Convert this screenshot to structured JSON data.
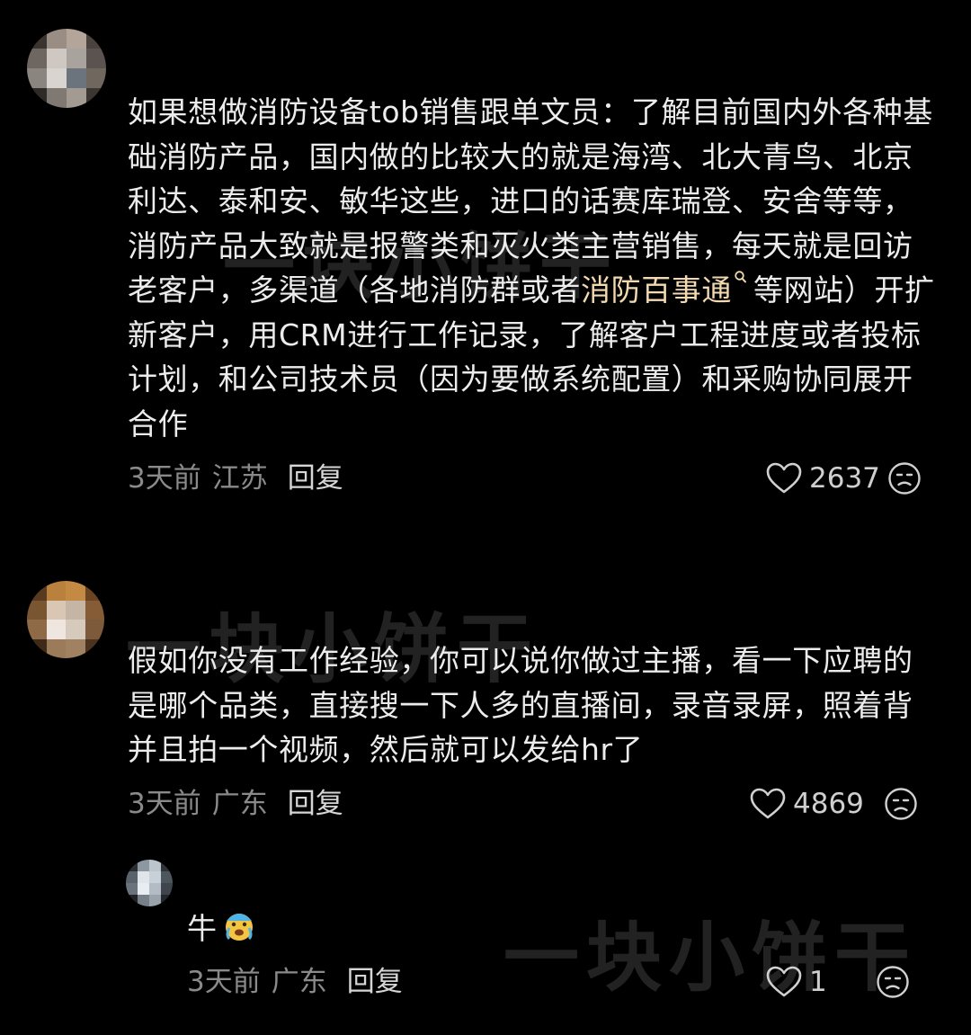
{
  "watermark": "一块小饼干",
  "comments": [
    {
      "text_before_link": "如果想做消防设备tob销售跟单文员：了解目前国内外各种基础消防产品，国内做的比较大的就是海湾、北大青鸟、北京利达、泰和安、敏华这些，进口的话赛库瑞登、安舍等等，消防产品大致就是报警类和灭火类主营销售，每天就是回访老客户，多渠道（各地消防群或者",
      "link_text": "消防百事通",
      "text_after_link": "等网站）开扩新客户，用CRM进行工作记录，了解客户工程进度或者投标计划，和公司技术员（因为要做系统配置）和采购协同展开合作",
      "time": "3天前",
      "location": "江苏",
      "reply_label": "回复",
      "likes": "2637"
    },
    {
      "text": "假如你没有工作经验，你可以说你做过主播，看一下应聘的是哪个品类，直接搜一下人多的直播间，录音录屏，照着背并且拍一个视频，然后就可以发给hr了",
      "time": "3天前",
      "location": "广东",
      "reply_label": "回复",
      "likes": "4869"
    },
    {
      "text": "牛",
      "time": "3天前",
      "location": "广东",
      "reply_label": "回复",
      "likes": "1"
    }
  ],
  "icons": {
    "like": "heart-outline-icon",
    "dislike": "unamused-face-icon",
    "search": "search-icon",
    "emoji": "crying-face-emoji"
  },
  "colors": {
    "background": "#000000",
    "text": "#ececec",
    "meta": "#8a8a8a",
    "link": "#f2d9b0"
  }
}
